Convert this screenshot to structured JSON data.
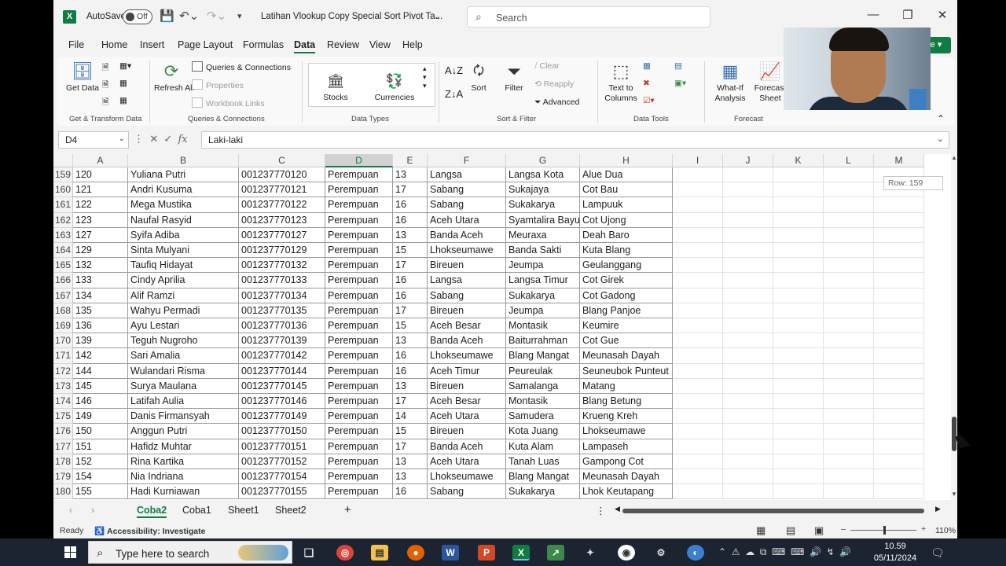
{
  "titlebar": {
    "autosave_label": "AutoSave",
    "autosave_state": "Off",
    "doc_title": "Latihan Vlookup Copy Special Sort Pivot Ta...",
    "search_placeholder": "Search"
  },
  "tabs": [
    "File",
    "Home",
    "Insert",
    "Page Layout",
    "Formulas",
    "Data",
    "Review",
    "View",
    "Help"
  ],
  "active_tab": "Data",
  "share_label": "re",
  "ribbon": {
    "get_data": "Get Data",
    "refresh_all": "Refresh All",
    "queries_connections": "Queries & Connections",
    "properties": "Properties",
    "workbook_links": "Workbook Links",
    "stocks": "Stocks",
    "currencies": "Currencies",
    "sort": "Sort",
    "filter": "Filter",
    "clear": "Clear",
    "reapply": "Reapply",
    "advanced": "Advanced",
    "text_to_columns": "Text to Columns",
    "what_if": "What-If Analysis",
    "forecast_sheet": "Forecast Sheet",
    "groups": {
      "get_transform": "Get & Transform Data",
      "queries": "Queries & Connections",
      "data_types": "Data Types",
      "sort_filter": "Sort & Filter",
      "data_tools": "Data Tools",
      "forecast": "Forecast"
    }
  },
  "formula_bar": {
    "name_box": "D4",
    "formula": "Laki-laki"
  },
  "columns": [
    "A",
    "B",
    "C",
    "D",
    "E",
    "F",
    "G",
    "H",
    "I",
    "J",
    "K",
    "L",
    "M"
  ],
  "row_tooltip": "Row: 159",
  "rows": [
    {
      "n": "159",
      "a": "120",
      "b": "Yuliana Putri",
      "c": "001237770120",
      "d": "Perempuan",
      "e": "13",
      "f": "Langsa",
      "g": "Langsa Kota",
      "h": "Alue Dua"
    },
    {
      "n": "160",
      "a": "121",
      "b": "Andri Kusuma",
      "c": "001237770121",
      "d": "Perempuan",
      "e": "17",
      "f": "Sabang",
      "g": "Sukajaya",
      "h": "Cot Bau"
    },
    {
      "n": "161",
      "a": "122",
      "b": "Mega Mustika",
      "c": "001237770122",
      "d": "Perempuan",
      "e": "16",
      "f": "Sabang",
      "g": "Sukakarya",
      "h": "Lampuuk"
    },
    {
      "n": "162",
      "a": "123",
      "b": "Naufal Rasyid",
      "c": "001237770123",
      "d": "Perempuan",
      "e": "16",
      "f": "Aceh Utara",
      "g": "Syamtalira Bayu",
      "h": "Cot Ujong"
    },
    {
      "n": "163",
      "a": "127",
      "b": "Syifa Adiba",
      "c": "001237770127",
      "d": "Perempuan",
      "e": "13",
      "f": "Banda Aceh",
      "g": "Meuraxa",
      "h": "Deah Baro"
    },
    {
      "n": "164",
      "a": "129",
      "b": "Sinta Mulyani",
      "c": "001237770129",
      "d": "Perempuan",
      "e": "15",
      "f": "Lhokseumawe",
      "g": "Banda Sakti",
      "h": "Kuta Blang"
    },
    {
      "n": "165",
      "a": "132",
      "b": "Taufiq Hidayat",
      "c": "001237770132",
      "d": "Perempuan",
      "e": "17",
      "f": "Bireuen",
      "g": "Jeumpa",
      "h": "Geulanggang"
    },
    {
      "n": "166",
      "a": "133",
      "b": "Cindy Aprilia",
      "c": "001237770133",
      "d": "Perempuan",
      "e": "16",
      "f": "Langsa",
      "g": "Langsa Timur",
      "h": "Cot Girek"
    },
    {
      "n": "167",
      "a": "134",
      "b": "Alif Ramzi",
      "c": "001237770134",
      "d": "Perempuan",
      "e": "16",
      "f": "Sabang",
      "g": "Sukakarya",
      "h": "Cot Gadong"
    },
    {
      "n": "168",
      "a": "135",
      "b": "Wahyu Permadi",
      "c": "001237770135",
      "d": "Perempuan",
      "e": "17",
      "f": "Bireuen",
      "g": "Jeumpa",
      "h": "Blang Panjoe"
    },
    {
      "n": "169",
      "a": "136",
      "b": "Ayu Lestari",
      "c": "001237770136",
      "d": "Perempuan",
      "e": "15",
      "f": "Aceh Besar",
      "g": "Montasik",
      "h": "Keumire"
    },
    {
      "n": "170",
      "a": "139",
      "b": "Teguh Nugroho",
      "c": "001237770139",
      "d": "Perempuan",
      "e": "13",
      "f": "Banda Aceh",
      "g": "Baiturrahman",
      "h": "Cot Gue"
    },
    {
      "n": "171",
      "a": "142",
      "b": "Sari Amalia",
      "c": "001237770142",
      "d": "Perempuan",
      "e": "16",
      "f": "Lhokseumawe",
      "g": "Blang Mangat",
      "h": "Meunasah Dayah"
    },
    {
      "n": "172",
      "a": "144",
      "b": "Wulandari Risma",
      "c": "001237770144",
      "d": "Perempuan",
      "e": "16",
      "f": "Aceh Timur",
      "g": "Peureulak",
      "h": "Seuneubok Punteut"
    },
    {
      "n": "173",
      "a": "145",
      "b": "Surya Maulana",
      "c": "001237770145",
      "d": "Perempuan",
      "e": "13",
      "f": "Bireuen",
      "g": "Samalanga",
      "h": "Matang"
    },
    {
      "n": "174",
      "a": "146",
      "b": "Latifah Aulia",
      "c": "001237770146",
      "d": "Perempuan",
      "e": "17",
      "f": "Aceh Besar",
      "g": "Montasik",
      "h": "Blang Betung"
    },
    {
      "n": "175",
      "a": "149",
      "b": "Danis Firmansyah",
      "c": "001237770149",
      "d": "Perempuan",
      "e": "14",
      "f": "Aceh Utara",
      "g": "Samudera",
      "h": "Krueng Kreh"
    },
    {
      "n": "176",
      "a": "150",
      "b": "Anggun Putri",
      "c": "001237770150",
      "d": "Perempuan",
      "e": "15",
      "f": "Bireuen",
      "g": "Kota Juang",
      "h": "Lhokseumawe"
    },
    {
      "n": "177",
      "a": "151",
      "b": "Hafidz Muhtar",
      "c": "001237770151",
      "d": "Perempuan",
      "e": "17",
      "f": "Banda Aceh",
      "g": "Kuta Alam",
      "h": "Lampaseh"
    },
    {
      "n": "178",
      "a": "152",
      "b": "Rina Kartika",
      "c": "001237770152",
      "d": "Perempuan",
      "e": "13",
      "f": "Aceh Utara",
      "g": "Tanah Luas",
      "h": "Gampong Cot"
    },
    {
      "n": "179",
      "a": "154",
      "b": "Nia Indriana",
      "c": "001237770154",
      "d": "Perempuan",
      "e": "13",
      "f": "Lhokseumawe",
      "g": "Blang Mangat",
      "h": "Meunasah Dayah"
    },
    {
      "n": "180",
      "a": "155",
      "b": "Hadi Kurniawan",
      "c": "001237770155",
      "d": "Perempuan",
      "e": "16",
      "f": "Sabang",
      "g": "Sukakarya",
      "h": "Lhok Keutapang"
    }
  ],
  "sheets": [
    "Coba2",
    "Coba1",
    "Sheet1",
    "Sheet2"
  ],
  "active_sheet": "Coba2",
  "status": {
    "ready": "Ready",
    "accessibility": "Accessibility: Investigate",
    "zoom": "110%"
  },
  "taskbar": {
    "search_placeholder": "Type here to search",
    "time": "10.59",
    "date": "05/11/2024"
  },
  "colors": {
    "excel_green": "#107c41",
    "taskbar": "#1c2331"
  }
}
